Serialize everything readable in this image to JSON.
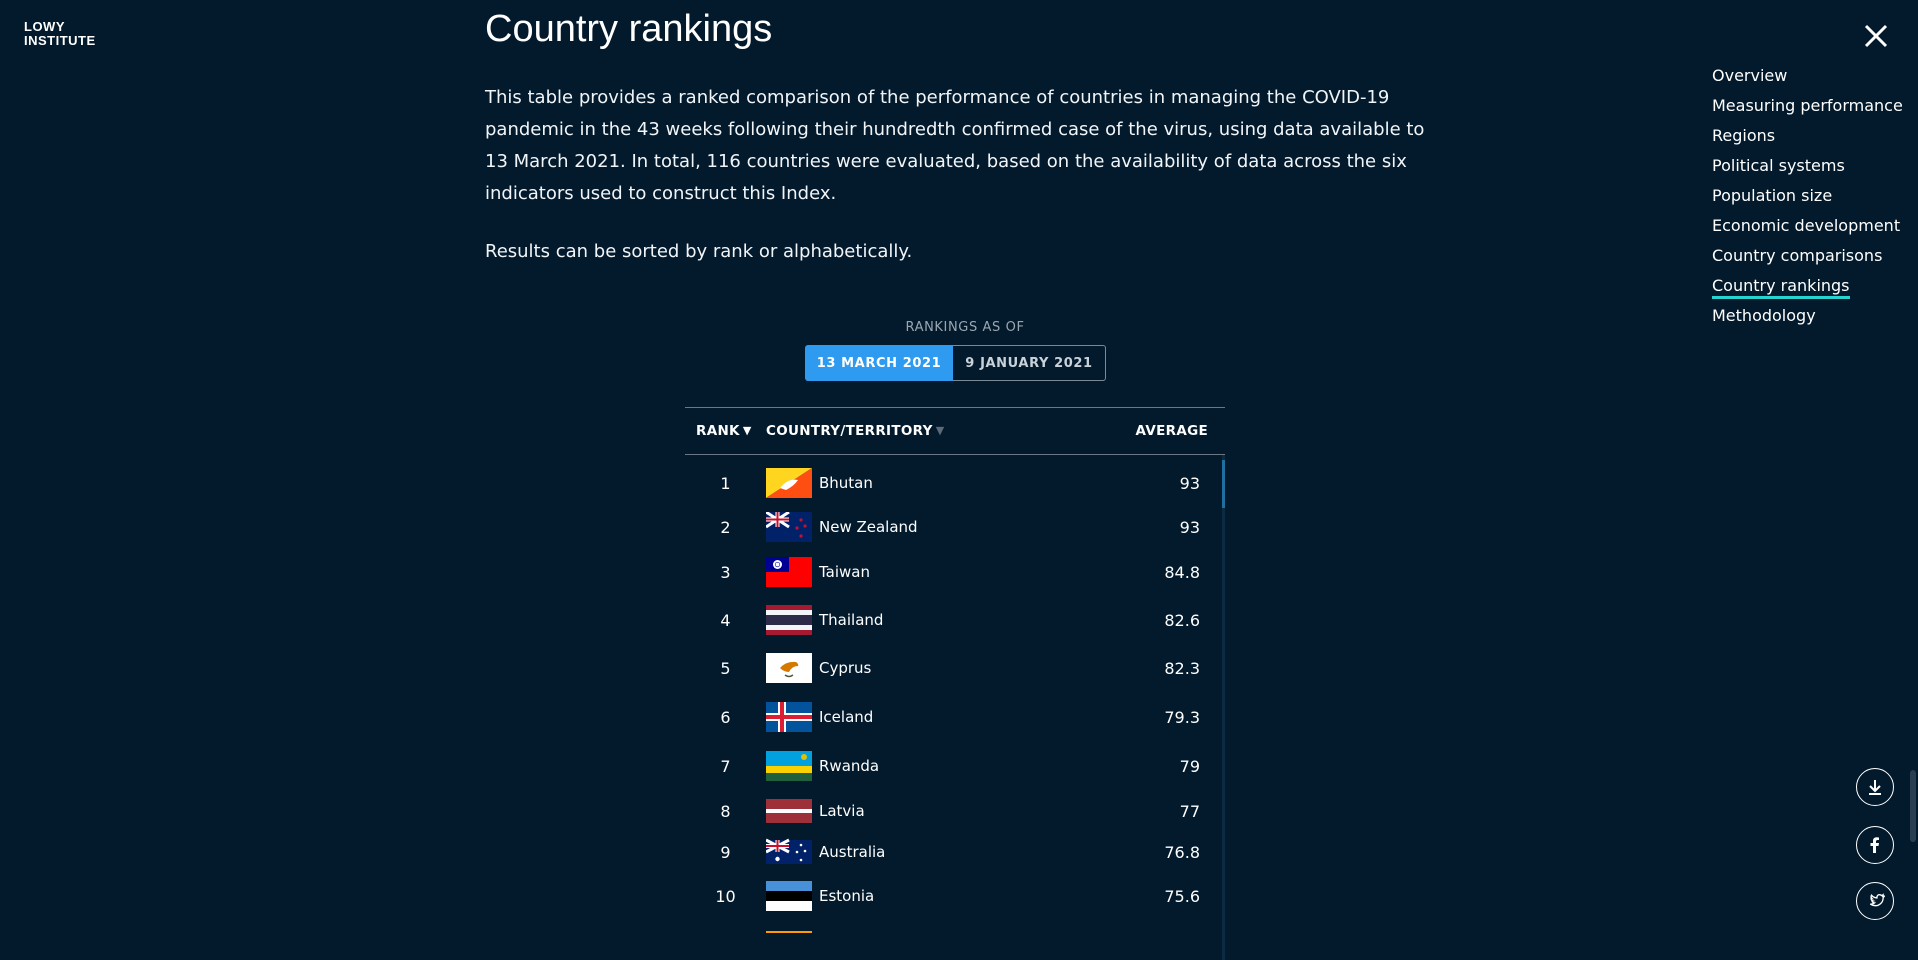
{
  "brand": {
    "line1": "LOWY",
    "line2": "INSTITUTE"
  },
  "page": {
    "title": "Country rankings",
    "intro": "This table provides a ranked comparison of the performance of countries in managing the COVID-19 pandemic in the 43 weeks following their hundredth confirmed case of the virus, using data available to 13 March 2021. In total, 116 countries were evaluated, based on the availability of data across the six indicators used to construct this Index.",
    "intro2": "Results can be sorted by rank or alphabetically."
  },
  "nav": {
    "items": [
      {
        "label": "Overview"
      },
      {
        "label": "Measuring performance"
      },
      {
        "label": "Regions"
      },
      {
        "label": "Political systems"
      },
      {
        "label": "Population size"
      },
      {
        "label": "Economic development"
      },
      {
        "label": "Country comparisons"
      },
      {
        "label": "Country rankings"
      },
      {
        "label": "Methodology"
      }
    ],
    "active": "Country rankings"
  },
  "rankings": {
    "caption": "RANKINGS AS OF",
    "dates": [
      "13 MARCH 2021",
      "9 JANUARY 2021"
    ],
    "selected_date": "13 MARCH 2021",
    "headers": {
      "rank": "RANK",
      "country": "COUNTRY/TERRITORY",
      "average": "AVERAGE"
    },
    "rows": [
      {
        "rank": "1",
        "country": "Bhutan",
        "average": "93"
      },
      {
        "rank": "2",
        "country": "New Zealand",
        "average": "93"
      },
      {
        "rank": "3",
        "country": "Taiwan",
        "average": "84.8"
      },
      {
        "rank": "4",
        "country": "Thailand",
        "average": "82.6"
      },
      {
        "rank": "5",
        "country": "Cyprus",
        "average": "82.3"
      },
      {
        "rank": "6",
        "country": "Iceland",
        "average": "79.3"
      },
      {
        "rank": "7",
        "country": "Rwanda",
        "average": "79"
      },
      {
        "rank": "8",
        "country": "Latvia",
        "average": "77"
      },
      {
        "rank": "9",
        "country": "Australia",
        "average": "76.8"
      },
      {
        "rank": "10",
        "country": "Estonia",
        "average": "75.6"
      }
    ]
  },
  "social": {
    "icons": [
      "download-icon",
      "facebook-icon",
      "twitter-icon"
    ]
  },
  "colors": {
    "background": "#031a2c",
    "accent": "#2e9bf0",
    "active_underline": "#25d3d0"
  }
}
